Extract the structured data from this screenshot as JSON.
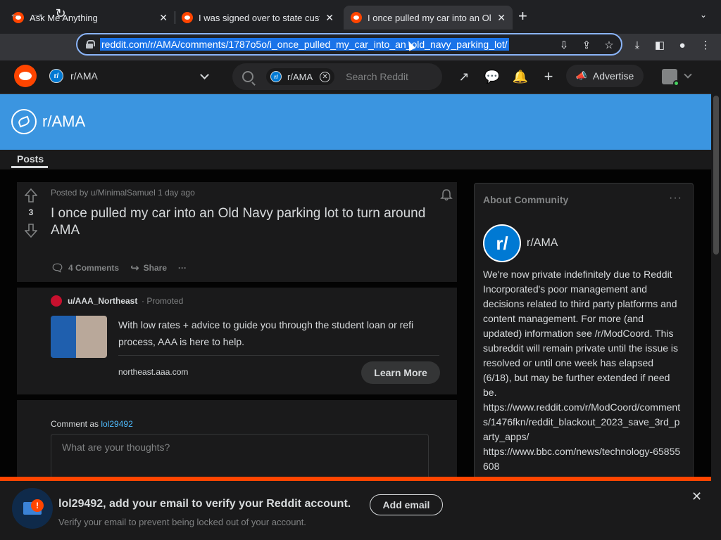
{
  "browser": {
    "tabs": [
      {
        "title": "Ask Me Anything",
        "close": "✕"
      },
      {
        "title": "I was signed over to state cust",
        "close": "✕"
      },
      {
        "title": "I once pulled my car into an Ol",
        "close": "✕"
      }
    ],
    "new_tab": "+",
    "tab_menu": "⌄",
    "url": "reddit.com/r/AMA/comments/1787o5o/i_once_pulled_my_car_into_an_old_navy_parking_lot/",
    "icons": [
      "back-icon",
      "forward-icon",
      "reload-icon",
      "lock-icon",
      "install-app-icon",
      "share-icon",
      "bookmark-star-icon",
      "download-icon",
      "side-panel-icon",
      "profile-icon",
      "kebab-menu-icon"
    ]
  },
  "header": {
    "subreddit": "r/AMA",
    "sub_glyph": "r/",
    "search_chip": "r/AMA",
    "search_placeholder": "Search Reddit",
    "advertise_label": "Advertise"
  },
  "banner": {
    "title": "r/AMA"
  },
  "tabs": {
    "posts": "Posts"
  },
  "post": {
    "votes": "3",
    "meta": "Posted by u/MinimalSamuel 1 day ago",
    "title": "I once pulled my car into an Old Navy parking lot to turn around AMA",
    "comments_label": "4 Comments",
    "share_label": "Share",
    "more": "···"
  },
  "ad": {
    "user": "u/AAA_Northeast",
    "promoted": "· Promoted",
    "text": "With low rates + advice to guide you through the student loan or refi process, AAA is here to help.",
    "domain": "northeast.aaa.com",
    "cta": "Learn More"
  },
  "comment": {
    "comment_as": "Comment as",
    "username": "lol29492",
    "placeholder": "What are your thoughts?"
  },
  "about": {
    "heading": "About Community",
    "dots": "···",
    "icon_glyph": "r/",
    "name": "r/AMA",
    "description": "We're now private indefinitely due to Reddit Incorporated's poor management and decisions related to third party platforms and content management. For more (and updated) information see /r/ModCoord. This subreddit will remain private until the issue is resolved or until one week has elapsed (6/18), but may be further extended if need be.",
    "link1": "https://www.reddit.com/r/ModCoord/comments/1476fkn/reddit_blackout_2023_save_3rd_party_apps/",
    "link2": "https://www.bbc.com/news/technology-65855608"
  },
  "email_prompt": {
    "title": "lol29492, add your email to verify your Reddit account.",
    "subtitle": "Verify your email to prevent being locked out of your account.",
    "button": "Add email",
    "badge": "!",
    "close": "✕"
  },
  "colors": {
    "reddit_orange": "#ff4500",
    "banner_blue": "#3b95e0",
    "link_blue": "#4fbcff"
  }
}
